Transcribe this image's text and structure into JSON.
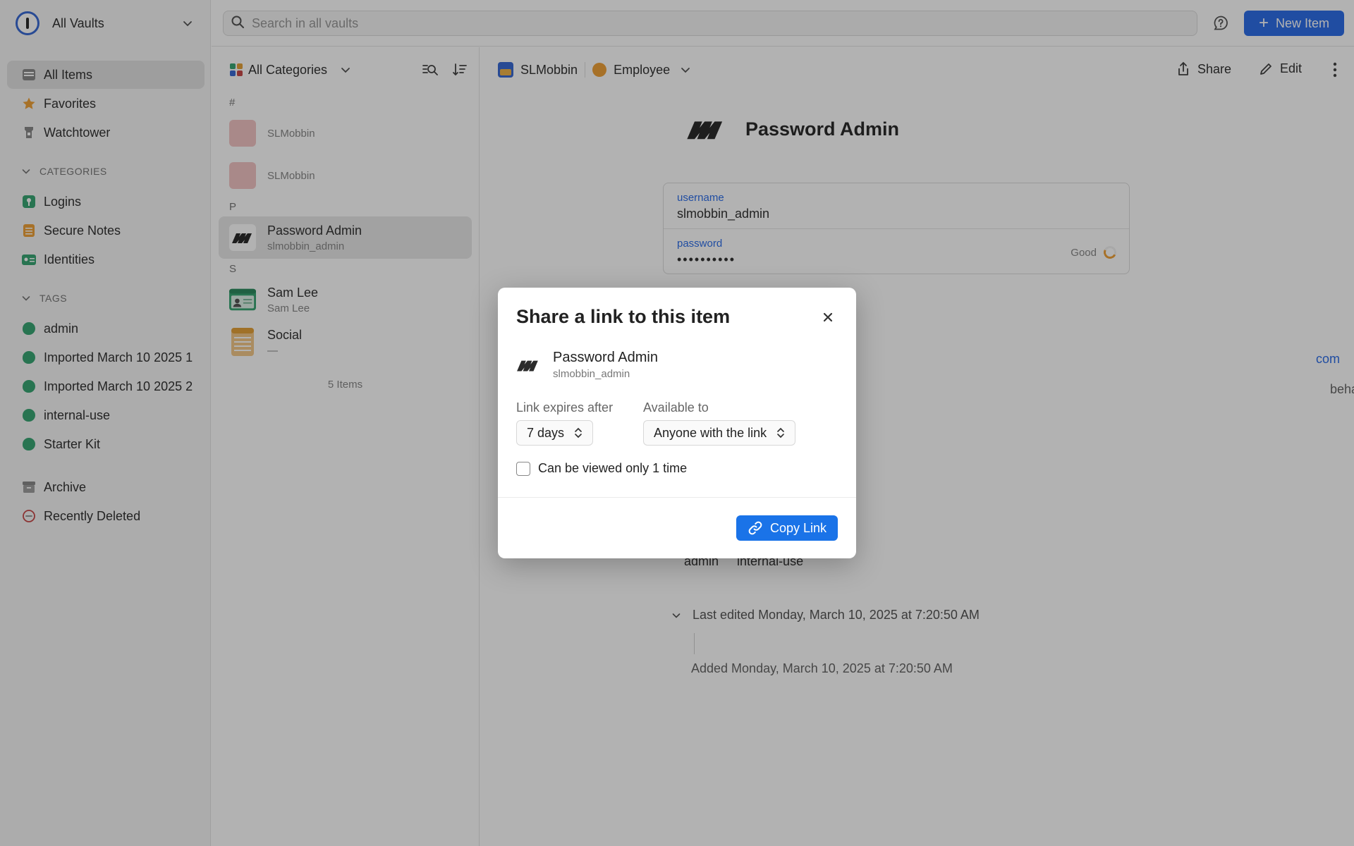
{
  "sidebar": {
    "vault_name": "All Vaults",
    "nav": [
      {
        "label": "All Items",
        "icon": "all-items-icon",
        "active": true
      },
      {
        "label": "Favorites",
        "icon": "star-icon"
      },
      {
        "label": "Watchtower",
        "icon": "watchtower-icon"
      }
    ],
    "categories_header": "CATEGORIES",
    "categories": [
      {
        "label": "Logins",
        "icon": "login-icon"
      },
      {
        "label": "Secure Notes",
        "icon": "note-icon"
      },
      {
        "label": "Identities",
        "icon": "identity-icon"
      }
    ],
    "tags_header": "TAGS",
    "tags": [
      {
        "label": "admin"
      },
      {
        "label": "Imported March 10 2025 1"
      },
      {
        "label": "Imported March 10 2025 2"
      },
      {
        "label": "internal-use"
      },
      {
        "label": "Starter Kit"
      }
    ],
    "archive": "Archive",
    "recently_deleted": "Recently Deleted"
  },
  "topbar": {
    "search_placeholder": "Search in all vaults",
    "new_item": "New Item"
  },
  "list": {
    "category_select": "All Categories",
    "groups": [
      {
        "letter": "#",
        "items": [
          {
            "title": "SLMobbin",
            "subtitle": "",
            "icon": "blank"
          },
          {
            "title": "SLMobbin",
            "subtitle": "",
            "icon": "blank"
          }
        ]
      },
      {
        "letter": "P",
        "items": [
          {
            "title": "Password Admin",
            "subtitle": "slmobbin_admin",
            "icon": "mobbin",
            "active": true
          }
        ]
      },
      {
        "letter": "S",
        "items": [
          {
            "title": "Sam Lee",
            "subtitle": "Sam Lee",
            "icon": "identity"
          },
          {
            "title": "Social",
            "subtitle": "—",
            "icon": "note"
          }
        ]
      }
    ],
    "count": "5 Items"
  },
  "detail": {
    "vault": "SLMobbin",
    "role": "Employee",
    "share": "Share",
    "edit": "Edit",
    "title": "Password Admin",
    "fields": {
      "username_label": "username",
      "username_value": "slmobbin_admin",
      "password_label": "password",
      "password_value": "••••••••••",
      "strength": "Good"
    },
    "website_fragment": "com",
    "behavior_fragment": "behavior",
    "tags": [
      "admin",
      "internal-use"
    ],
    "last_edited": "Last edited Monday, March 10, 2025 at 7:20:50 AM",
    "added": "Added Monday, March 10, 2025 at 7:20:50 AM"
  },
  "dialog": {
    "title": "Share a link to this item",
    "item_title": "Password Admin",
    "item_subtitle": "slmobbin_admin",
    "expires_label": "Link expires after",
    "expires_value": "7 days",
    "available_label": "Available to",
    "available_value": "Anyone with the link",
    "view_once_label": "Can be viewed only 1 time",
    "copy_link": "Copy Link"
  },
  "colors": {
    "accent": "#1a73e8",
    "tag_green": "#3aa674",
    "field_label": "#2f6fe8"
  }
}
